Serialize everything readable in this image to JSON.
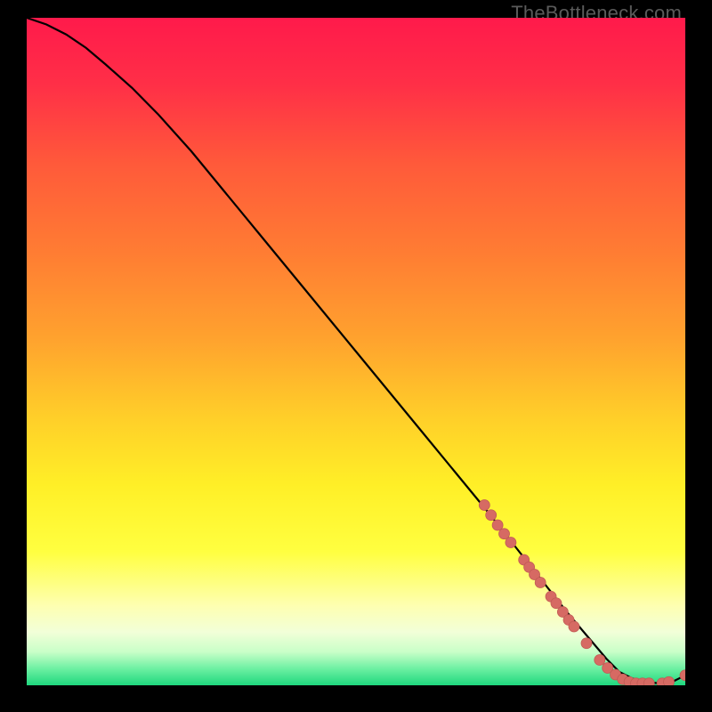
{
  "watermark": "TheBottleneck.com",
  "colors": {
    "line": "#000000",
    "marker_fill": "#d66a63",
    "marker_stroke": "#c05a54",
    "bg_black": "#000000"
  },
  "gradient_stops": [
    {
      "offset": 0.0,
      "color": "#ff1a4b"
    },
    {
      "offset": 0.1,
      "color": "#ff2f47"
    },
    {
      "offset": 0.22,
      "color": "#ff5a3a"
    },
    {
      "offset": 0.35,
      "color": "#ff7c33"
    },
    {
      "offset": 0.48,
      "color": "#ffa22e"
    },
    {
      "offset": 0.6,
      "color": "#ffcf29"
    },
    {
      "offset": 0.7,
      "color": "#ffef27"
    },
    {
      "offset": 0.8,
      "color": "#ffff40"
    },
    {
      "offset": 0.88,
      "color": "#feffb0"
    },
    {
      "offset": 0.92,
      "color": "#f2ffd8"
    },
    {
      "offset": 0.95,
      "color": "#c9ffc8"
    },
    {
      "offset": 0.975,
      "color": "#6df0a2"
    },
    {
      "offset": 1.0,
      "color": "#1fd77e"
    }
  ],
  "chart_data": {
    "type": "line",
    "title": "",
    "xlabel": "",
    "ylabel": "",
    "xlim": [
      0,
      100
    ],
    "ylim": [
      0,
      100
    ],
    "series": [
      {
        "name": "curve",
        "x": [
          0,
          3,
          6,
          9,
          12,
          16,
          20,
          25,
          30,
          35,
          40,
          45,
          50,
          55,
          60,
          65,
          70,
          74,
          78,
          82,
          85,
          88,
          90,
          92,
          94,
          96,
          98,
          100
        ],
        "y": [
          100,
          99,
          97.5,
          95.5,
          93,
          89.5,
          85.5,
          80,
          74,
          68,
          62,
          56,
          50,
          44,
          38,
          32,
          26,
          21,
          16,
          11,
          7.5,
          4,
          2,
          1,
          0.5,
          0.3,
          0.5,
          1.5
        ]
      }
    ],
    "markers": [
      {
        "x": 69.5,
        "y": 27
      },
      {
        "x": 70.5,
        "y": 25.5
      },
      {
        "x": 71.5,
        "y": 24
      },
      {
        "x": 72.5,
        "y": 22.7
      },
      {
        "x": 73.5,
        "y": 21.4
      },
      {
        "x": 75.5,
        "y": 18.8
      },
      {
        "x": 76.3,
        "y": 17.7
      },
      {
        "x": 77.1,
        "y": 16.6
      },
      {
        "x": 78.0,
        "y": 15.4
      },
      {
        "x": 79.6,
        "y": 13.3
      },
      {
        "x": 80.4,
        "y": 12.3
      },
      {
        "x": 81.4,
        "y": 11.0
      },
      {
        "x": 82.3,
        "y": 9.8
      },
      {
        "x": 83.1,
        "y": 8.8
      },
      {
        "x": 85.0,
        "y": 6.3
      },
      {
        "x": 87.0,
        "y": 3.8
      },
      {
        "x": 88.2,
        "y": 2.6
      },
      {
        "x": 89.4,
        "y": 1.6
      },
      {
        "x": 90.5,
        "y": 0.9
      },
      {
        "x": 91.5,
        "y": 0.5
      },
      {
        "x": 92.5,
        "y": 0.3
      },
      {
        "x": 93.5,
        "y": 0.3
      },
      {
        "x": 94.5,
        "y": 0.3
      },
      {
        "x": 96.5,
        "y": 0.3
      },
      {
        "x": 97.5,
        "y": 0.5
      },
      {
        "x": 100.0,
        "y": 1.5
      }
    ],
    "marker_radius_px": 6
  }
}
